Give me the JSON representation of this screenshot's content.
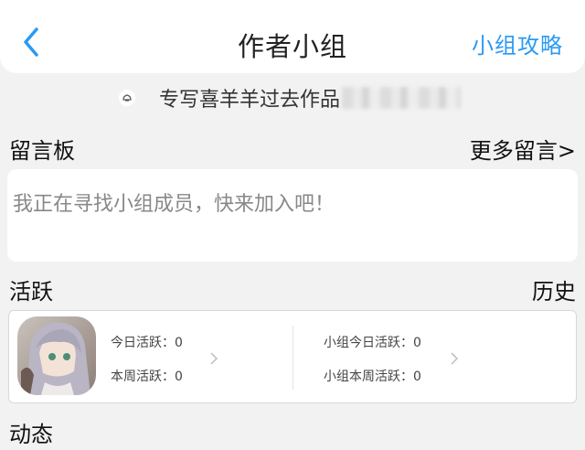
{
  "header": {
    "title": "作者小组",
    "guide_label": "小组攻略",
    "back_icon": "chevron-left-icon",
    "accent_color": "#2b9af3"
  },
  "notice": {
    "icon": "announcement-icon",
    "text": "专写喜羊羊过去作品"
  },
  "message_board": {
    "title": "留言板",
    "more_label": "更多留言>",
    "placeholder": "我正在寻找小组成员，快来加入吧！"
  },
  "activity": {
    "title": "活跃",
    "history_label": "历史",
    "personal": {
      "today_label": "今日活跃：",
      "today_value": "0",
      "week_label": "本周活跃：",
      "week_value": "0"
    },
    "group": {
      "today_label": "小组今日活跃：",
      "today_value": "0",
      "week_label": "小组本周活跃：",
      "week_value": "0"
    }
  },
  "dynamics": {
    "title": "动态"
  }
}
